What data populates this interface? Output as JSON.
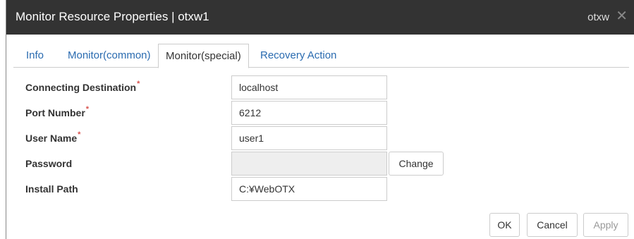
{
  "dialog": {
    "title": "Monitor Resource Properties | otxw1",
    "title_right": "otxw",
    "close_glyph": "✕"
  },
  "tabs": [
    {
      "label": "Info",
      "active": false
    },
    {
      "label": "Monitor(common)",
      "active": false
    },
    {
      "label": "Monitor(special)",
      "active": true
    },
    {
      "label": "Recovery Action",
      "active": false
    }
  ],
  "fields": {
    "connecting_destination": {
      "label": "Connecting Destination",
      "required_mark": "*",
      "value": "localhost"
    },
    "port_number": {
      "label": "Port Number",
      "required_mark": "*",
      "value": "6212"
    },
    "user_name": {
      "label": "User Name",
      "required_mark": "*",
      "value": "user1"
    },
    "password": {
      "label": "Password",
      "value": ""
    },
    "install_path": {
      "label": "Install Path",
      "value": "C:¥WebOTX"
    }
  },
  "buttons": {
    "change": "Change",
    "ok": "OK",
    "cancel": "Cancel",
    "apply": "Apply"
  },
  "colors": {
    "titlebar": "#333333",
    "tab_link": "#2a6bb0",
    "required": "#d9534f"
  },
  "icons": {
    "close": "close-icon"
  }
}
